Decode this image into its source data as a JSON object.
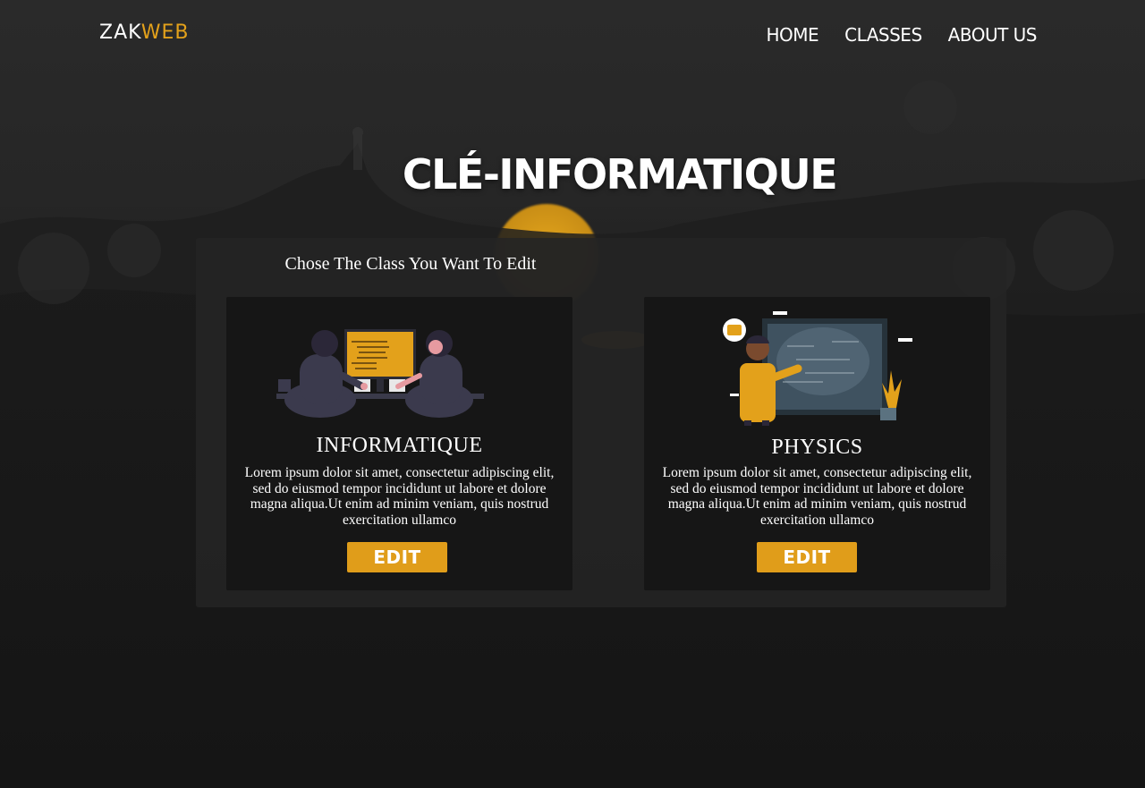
{
  "header": {
    "logo_main": "ZAK",
    "logo_accent": "WEB",
    "nav": [
      {
        "label": "HOME"
      },
      {
        "label": "CLASSES"
      },
      {
        "label": "ABOUT US"
      }
    ]
  },
  "hero": {
    "title": "CLÉ-INFORMATIQUE"
  },
  "panel": {
    "heading": "Chose The Class You Want To Edit",
    "cards": [
      {
        "title": "INFORMATIQUE",
        "description": "Lorem ipsum dolor sit amet, consectetur adipiscing elit, sed do eiusmod tempor incididunt ut labore et dolore magna aliqua.Ut enim ad minim veniam, quis nostrud exercitation ullamco",
        "button_label": "EDIT",
        "illustration": "people-at-computer-illustration"
      },
      {
        "title": "PHYSICS",
        "description": "Lorem ipsum dolor sit amet, consectetur adipiscing elit, sed do eiusmod tempor incididunt ut labore et dolore magna aliqua.Ut enim ad minim veniam, quis nostrud exercitation ullamco",
        "button_label": "EDIT",
        "illustration": "teacher-at-chalkboard-illustration"
      }
    ]
  },
  "colors": {
    "accent": "#e09d1a",
    "background": "#141414",
    "card": "#161616",
    "panel": "#242424"
  }
}
